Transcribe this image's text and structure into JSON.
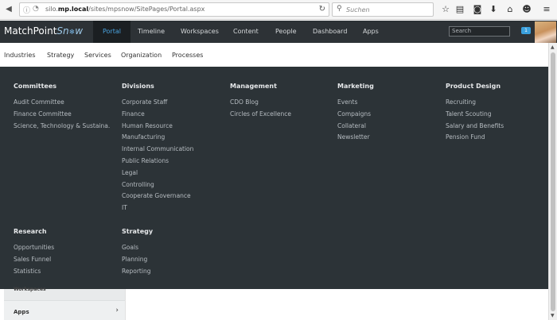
{
  "browser": {
    "url_prefix": "silo.",
    "url_domain": "mp.local",
    "url_path": "/sites/mpsnow/SitePages/Portal.aspx",
    "search_placeholder": "Suchen"
  },
  "app": {
    "logo_main": "MatchPoint",
    "logo_snow": "Sn",
    "logo_snow2": "w",
    "nav": [
      "Portal",
      "Timeline",
      "Workspaces",
      "Content",
      "People",
      "Dashboard",
      "Apps"
    ],
    "search_placeholder": "Search",
    "notification_count": "1"
  },
  "subnav": [
    "Industries",
    "Strategy",
    "Services",
    "Organization",
    "Processes"
  ],
  "mega_menu": {
    "columns": [
      {
        "title": "Committees",
        "links": [
          "Audit Committee",
          "Finance Committee",
          "Science, Technology & Sustaina..."
        ]
      },
      {
        "title": "Divisions",
        "links": [
          "Corporate Staff",
          "Finance",
          "Human Resource",
          "Manufacturing",
          "Internal Communication",
          "Public Relations",
          "Legal",
          "Controlling",
          "Cooperate Governance",
          "IT"
        ]
      },
      {
        "title": "Management",
        "links": [
          "CDO Blog",
          "Circles of Excellence"
        ]
      },
      {
        "title": "Marketing",
        "links": [
          "Events",
          "Compaigns",
          "Collateral",
          "Newsletter"
        ]
      },
      {
        "title": "Product Design",
        "links": [
          "Recruiting",
          "Talent Scouting",
          "Salary and Benefits",
          "Pension Fund"
        ]
      },
      {
        "title": "Research",
        "links": [
          "Opportunities",
          "Sales Funnel",
          "Statistics"
        ]
      },
      {
        "title": "Strategy",
        "links": [
          "Goals",
          "Planning",
          "Reporting"
        ]
      }
    ]
  },
  "leftnav": {
    "prev_label": "Workspaces",
    "apps_label": "Apps"
  }
}
